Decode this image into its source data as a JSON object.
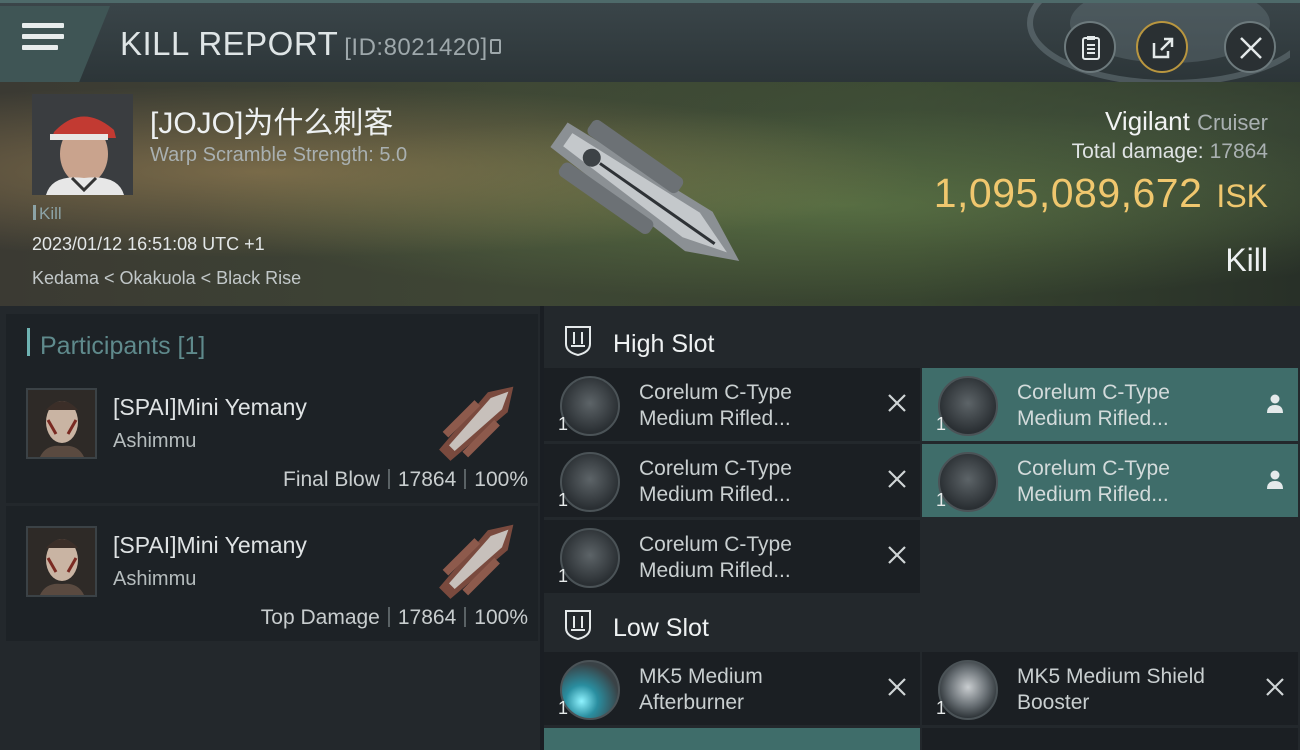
{
  "header": {
    "title": "KILL REPORT",
    "kill_id": "[ID:8021420]"
  },
  "victim": {
    "name": "[JOJO]为什么刺客",
    "warp_scramble": "Warp Scramble Strength: 5.0",
    "tag": "Kill",
    "datetime": "2023/01/12 16:51:08 UTC +1",
    "location": "Kedama < Okakuola < Black Rise",
    "ship_name": "Vigilant",
    "ship_class": "Cruiser",
    "total_damage_label": "Total damage:",
    "total_damage": "17864",
    "isk_value": "1,095,089,672",
    "isk_unit": "ISK",
    "result": "Kill"
  },
  "participants": {
    "label": "Participants [1]",
    "rows": [
      {
        "name": "[SPAI]Mini Yemany",
        "corp": "Ashimmu",
        "role": "Final Blow",
        "damage": "17864",
        "percent": "100%"
      },
      {
        "name": "[SPAI]Mini Yemany",
        "corp": "Ashimmu",
        "role": "Top Damage",
        "damage": "17864",
        "percent": "100%"
      }
    ]
  },
  "high_slot": {
    "title": "High Slot",
    "modules": [
      {
        "name": "Corelum C-Type Medium Rifled...",
        "qty": "1",
        "status": "destroyed"
      },
      {
        "name": "Corelum C-Type Medium Rifled...",
        "qty": "1",
        "status": "dropped"
      },
      {
        "name": "Corelum C-Type Medium Rifled...",
        "qty": "1",
        "status": "destroyed"
      },
      {
        "name": "Corelum C-Type Medium Rifled...",
        "qty": "1",
        "status": "dropped"
      },
      {
        "name": "Corelum C-Type Medium Rifled...",
        "qty": "1",
        "status": "destroyed"
      }
    ]
  },
  "low_slot": {
    "title": "Low Slot",
    "modules": [
      {
        "name": "MK5 Medium Afterburner",
        "qty": "1",
        "status": "destroyed"
      },
      {
        "name": "MK5 Medium Shield Booster",
        "qty": "1",
        "status": "destroyed"
      }
    ]
  },
  "colors": {
    "accent": "#6fb3b3",
    "isk": "#f0c76e",
    "dropped_bg": "#3f6d6a",
    "panel_bg": "#1d2226"
  }
}
